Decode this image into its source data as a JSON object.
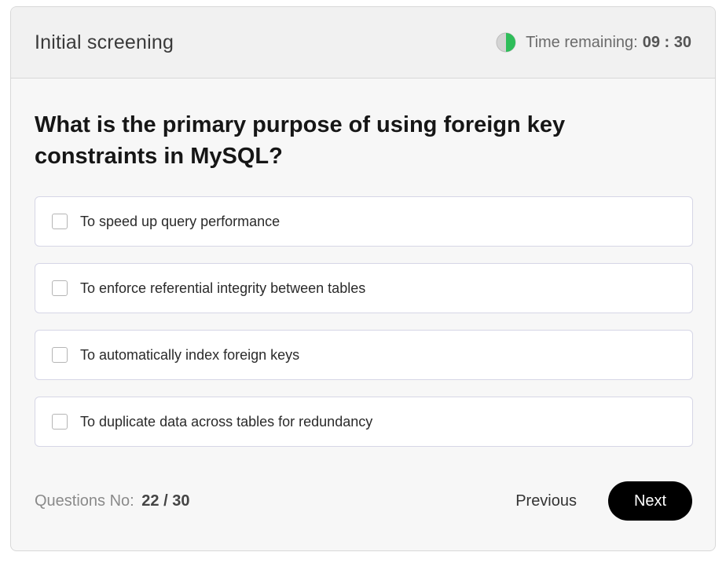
{
  "header": {
    "title": "Initial screening",
    "timer_label": "Time remaining:",
    "timer_value": "09 : 30",
    "timer_icon": "half-circle-progress-icon",
    "timer_progress": 0.5,
    "timer_colors": {
      "elapsed": "#cfcfcf",
      "remaining": "#2ebd59"
    }
  },
  "question": {
    "text": "What is the primary purpose of using foreign key constraints in MySQL?"
  },
  "options": [
    {
      "label": "To speed up query performance",
      "checked": false
    },
    {
      "label": "To enforce referential integrity between tables",
      "checked": false
    },
    {
      "label": "To automatically index foreign keys",
      "checked": false
    },
    {
      "label": "To duplicate data across tables for redundancy",
      "checked": false
    }
  ],
  "footer": {
    "question_no_label": "Questions No:",
    "question_no_value": "22 / 30",
    "previous_label": "Previous",
    "next_label": "Next"
  },
  "colors": {
    "accent": "#000000",
    "timer_green": "#2ebd59"
  }
}
